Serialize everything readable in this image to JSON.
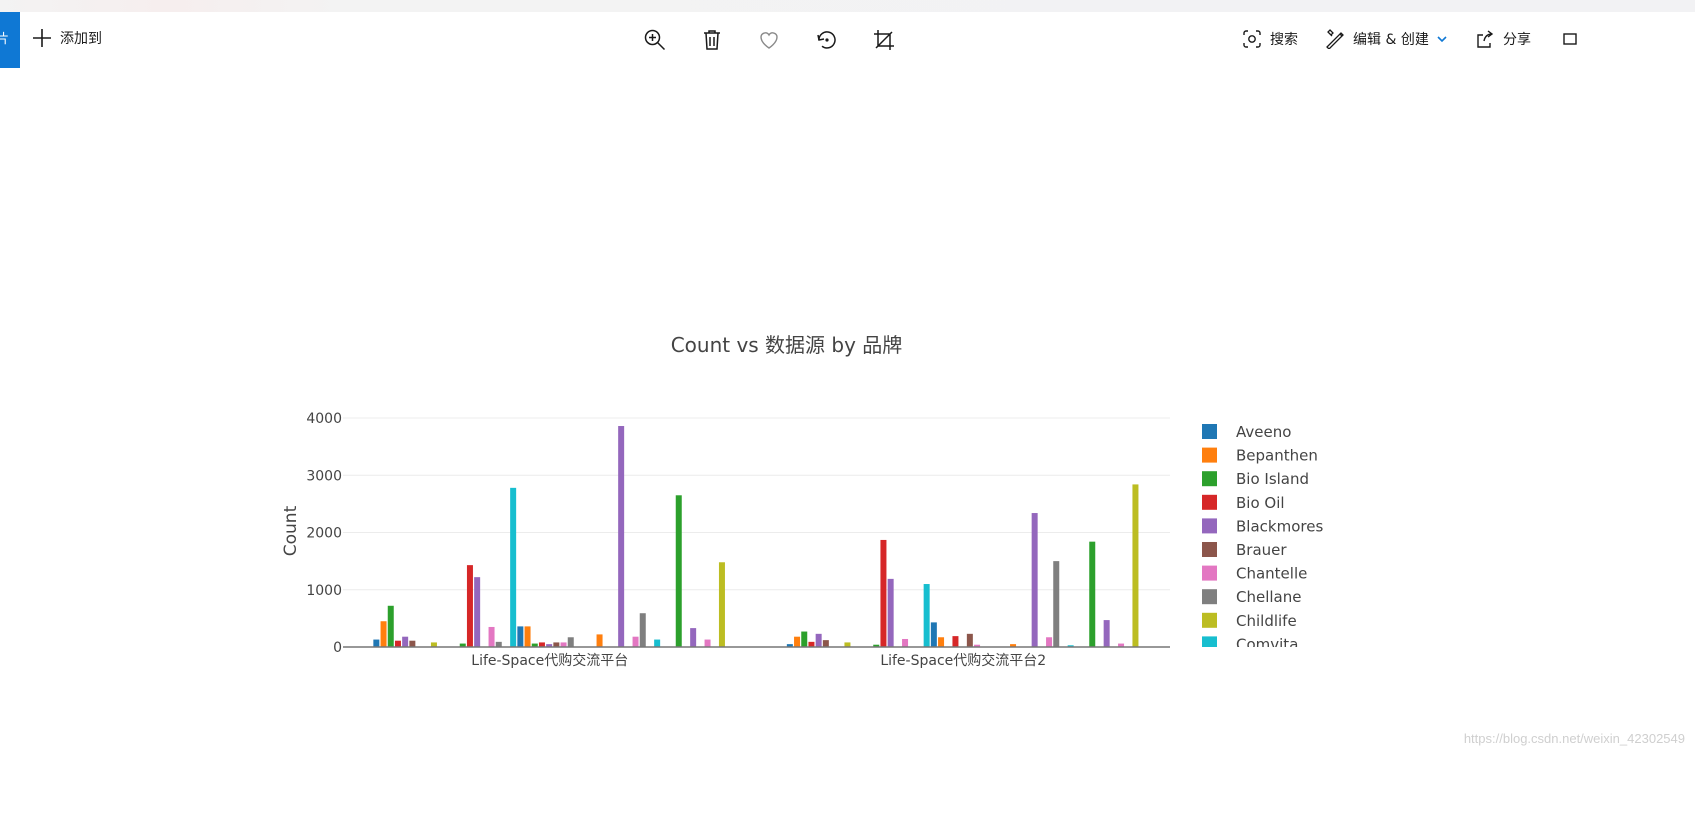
{
  "toolbar": {
    "tab_glyph": "片",
    "add_label": "添加到",
    "search_label": "搜索",
    "edit_label": "编辑 & 创建",
    "share_label": "分享"
  },
  "watermark": "https://blog.csdn.net/weixin_42302549",
  "chart_data": {
    "type": "bar",
    "title": "Count vs 数据源 by 品牌",
    "xlabel": "",
    "ylabel": "Count",
    "ylim": [
      0,
      4000
    ],
    "yticks": [
      0,
      1000,
      2000,
      3000,
      4000
    ],
    "grid": true,
    "legend_position": "right",
    "categories": [
      "Life-Space代购交流平台",
      "Life-Space代购交流平台2"
    ],
    "palette": [
      "#1f77b4",
      "#ff7f0e",
      "#2ca02c",
      "#d62728",
      "#9467bd",
      "#8c564b",
      "#e377c2",
      "#7f7f7f",
      "#bcbd22",
      "#17becf"
    ],
    "legend": [
      "Aveeno",
      "Bepanthen",
      "Bio Island",
      "Bio Oil",
      "Blackmores",
      "Brauer",
      "Chantelle",
      "Chellane",
      "Childlife",
      "Comvita"
    ],
    "bars": [
      [
        130,
        450,
        720,
        110,
        180,
        110,
        0,
        0,
        80,
        0,
        0,
        0,
        60,
        1430,
        1220,
        0,
        350,
        90,
        0,
        2780,
        360,
        360,
        60,
        80,
        50,
        80,
        80,
        170,
        0,
        0,
        0,
        220,
        0,
        0,
        3860,
        0,
        180,
        590,
        0,
        130,
        0,
        0,
        2650,
        0,
        330,
        0,
        130,
        0,
        1480
      ],
      [
        50,
        180,
        270,
        90,
        230,
        120,
        0,
        0,
        80,
        0,
        0,
        0,
        40,
        1870,
        1190,
        0,
        140,
        0,
        0,
        1100,
        430,
        170,
        0,
        190,
        0,
        230,
        40,
        0,
        0,
        0,
        0,
        50,
        0,
        0,
        2340,
        0,
        170,
        1500,
        0,
        30,
        0,
        0,
        1840,
        0,
        470,
        0,
        60,
        0,
        2840
      ]
    ]
  }
}
